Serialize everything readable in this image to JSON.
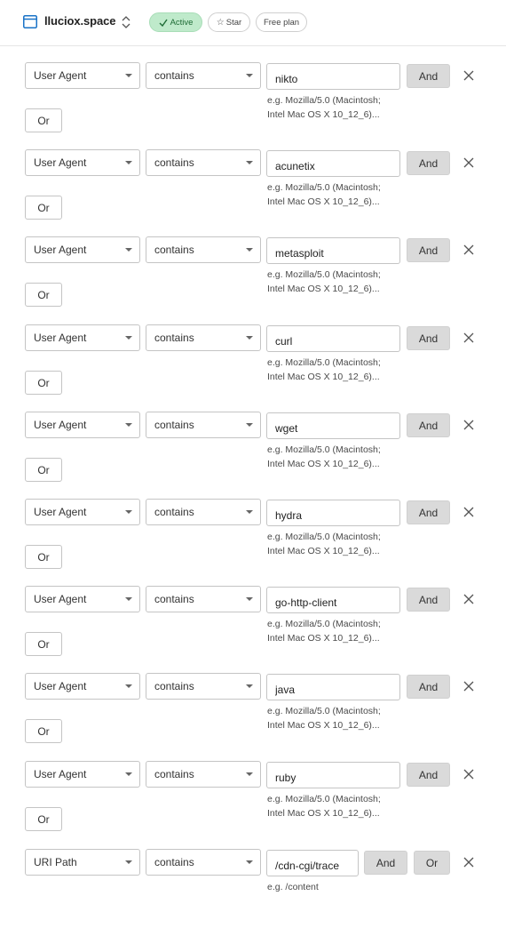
{
  "header": {
    "site_name": "lluciox.space",
    "status_badge": "Active",
    "star_label": "Star",
    "plan_badge": "Free plan"
  },
  "colors": {
    "active_bg": "#bfeacb",
    "active_text": "#1d6b35",
    "button_gray": "#dadada"
  },
  "rules": [
    {
      "field": "User Agent",
      "operator": "contains",
      "value": "nikto",
      "hint_line1": "e.g. Mozilla/5.0 (Macintosh;",
      "hint_line2": "Intel Mac OS X 10_12_6)...",
      "and_label": "And",
      "or_label": "Or"
    },
    {
      "field": "User Agent",
      "operator": "contains",
      "value": "acunetix",
      "hint_line1": "e.g. Mozilla/5.0 (Macintosh;",
      "hint_line2": "Intel Mac OS X 10_12_6)...",
      "and_label": "And",
      "or_label": "Or"
    },
    {
      "field": "User Agent",
      "operator": "contains",
      "value": "metasploit",
      "hint_line1": "e.g. Mozilla/5.0 (Macintosh;",
      "hint_line2": "Intel Mac OS X 10_12_6)...",
      "and_label": "And",
      "or_label": "Or"
    },
    {
      "field": "User Agent",
      "operator": "contains",
      "value": "curl",
      "hint_line1": "e.g. Mozilla/5.0 (Macintosh;",
      "hint_line2": "Intel Mac OS X 10_12_6)...",
      "and_label": "And",
      "or_label": "Or"
    },
    {
      "field": "User Agent",
      "operator": "contains",
      "value": "wget",
      "hint_line1": "e.g. Mozilla/5.0 (Macintosh;",
      "hint_line2": "Intel Mac OS X 10_12_6)...",
      "and_label": "And",
      "or_label": "Or"
    },
    {
      "field": "User Agent",
      "operator": "contains",
      "value": "hydra",
      "hint_line1": "e.g. Mozilla/5.0 (Macintosh;",
      "hint_line2": "Intel Mac OS X 10_12_6)...",
      "and_label": "And",
      "or_label": "Or"
    },
    {
      "field": "User Agent",
      "operator": "contains",
      "value": "go-http-client",
      "hint_line1": "e.g. Mozilla/5.0 (Macintosh;",
      "hint_line2": "Intel Mac OS X 10_12_6)...",
      "and_label": "And",
      "or_label": "Or"
    },
    {
      "field": "User Agent",
      "operator": "contains",
      "value": "java",
      "hint_line1": "e.g. Mozilla/5.0 (Macintosh;",
      "hint_line2": "Intel Mac OS X 10_12_6)...",
      "and_label": "And",
      "or_label": "Or"
    },
    {
      "field": "User Agent",
      "operator": "contains",
      "value": "ruby",
      "hint_line1": "e.g. Mozilla/5.0 (Macintosh;",
      "hint_line2": "Intel Mac OS X 10_12_6)...",
      "and_label": "And",
      "or_label": "Or"
    }
  ],
  "last_rule": {
    "field": "URI Path",
    "operator": "contains",
    "value": "/cdn-cgi/trace",
    "hint": "e.g. /content",
    "and_label": "And",
    "or_label": "Or"
  }
}
